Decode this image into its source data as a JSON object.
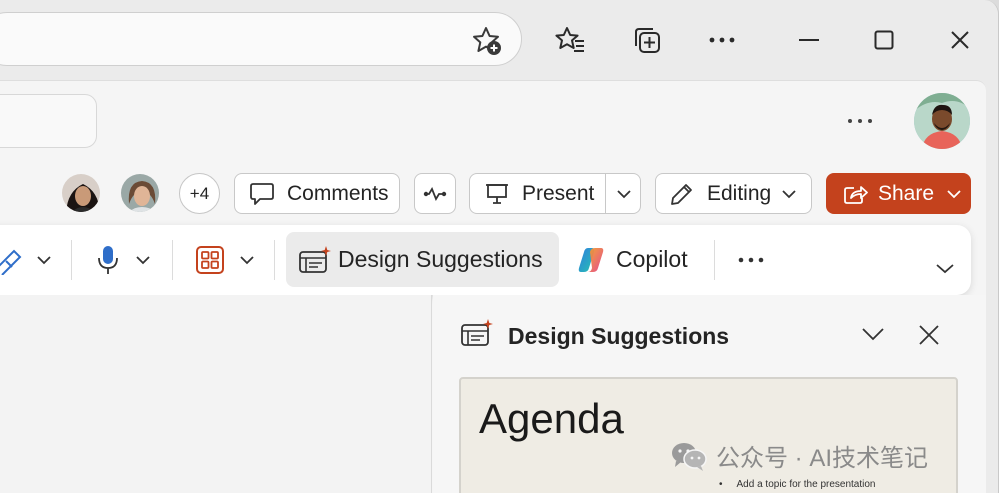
{
  "browser": {
    "icons": [
      "favorite-add-icon",
      "favorites-icon",
      "collections-icon",
      "more-icon",
      "minimize-icon",
      "maximize-icon",
      "close-icon"
    ]
  },
  "header": {
    "collaborators_extra": "+4",
    "comments_label": "Comments",
    "present_label": "Present",
    "editing_label": "Editing",
    "share_label": "Share"
  },
  "ribbon": {
    "design_suggestions_label": "Design Suggestions",
    "copilot_label": "Copilot"
  },
  "pane": {
    "title": "Design Suggestions",
    "thumbnail": {
      "title": "Agenda",
      "bullet": "Add a topic for the presentation"
    }
  },
  "watermark": {
    "text": "公众号 · AI技术笔记"
  },
  "colors": {
    "share": "#c4421d",
    "accent_icon": "#c4421d",
    "mic": "#2f6ec9"
  }
}
